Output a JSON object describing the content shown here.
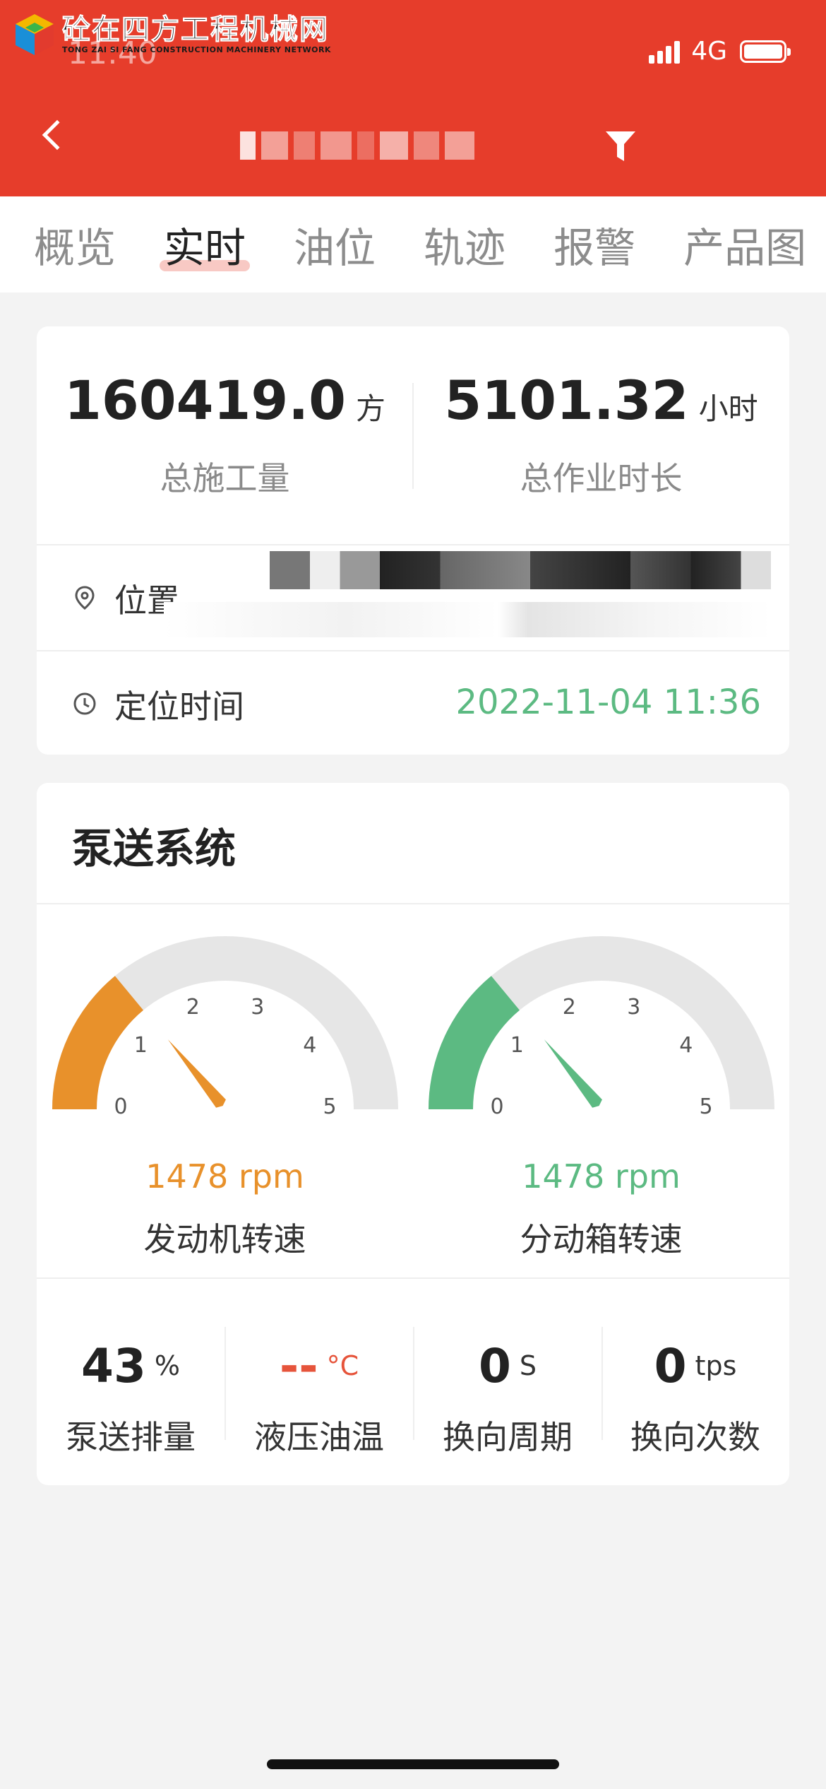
{
  "status_bar": {
    "time": "11:40",
    "network": "4G",
    "signal_bars": 4,
    "battery_level": 1.0
  },
  "watermark": {
    "main": "砼在四方工程机械网",
    "sub": "TONG ZAI SI FANG CONSTRUCTION MACHINERY NETWORK"
  },
  "header": {
    "back_icon": "chevron-left-icon",
    "title": "",
    "bg_color": "#e63d2b"
  },
  "tabs": [
    {
      "label": "概览",
      "active": false
    },
    {
      "label": "实时",
      "active": true
    },
    {
      "label": "油位",
      "active": false
    },
    {
      "label": "轨迹",
      "active": false
    },
    {
      "label": "报警",
      "active": false
    },
    {
      "label": "产品图",
      "active": false
    }
  ],
  "summary": {
    "total_volume": {
      "value": "160419.0",
      "unit": "方",
      "label": "总施工量"
    },
    "total_hours": {
      "value": "5101.32",
      "unit": "小时",
      "label": "总作业时长"
    },
    "location": {
      "icon": "location-pin-icon",
      "label": "位置",
      "value": ""
    },
    "locate_time": {
      "icon": "clock-icon",
      "label": "定位时间",
      "value": "2022-11-04 11:36"
    }
  },
  "pump_system": {
    "title": "泵送系统",
    "gauges": [
      {
        "value_text": "1478 rpm",
        "label": "发动机转速",
        "level": 0.28,
        "color": "#e8912b",
        "ticks": [
          "0",
          "1",
          "2",
          "3",
          "4",
          "5"
        ]
      },
      {
        "value_text": "1478 rpm",
        "label": "分动箱转速",
        "level": 0.28,
        "color": "#5cba82",
        "ticks": [
          "0",
          "1",
          "2",
          "3",
          "4",
          "5"
        ]
      }
    ],
    "metrics": [
      {
        "value": "43",
        "unit": "%",
        "label": "泵送排量",
        "color": "#222222"
      },
      {
        "value": "--",
        "unit": "°C",
        "label": "液压油温",
        "color": "#e6543b"
      },
      {
        "value": "0",
        "unit": "S",
        "label": "换向周期",
        "color": "#222222"
      },
      {
        "value": "0",
        "unit": "tps",
        "label": "换向次数",
        "color": "#222222"
      }
    ]
  }
}
